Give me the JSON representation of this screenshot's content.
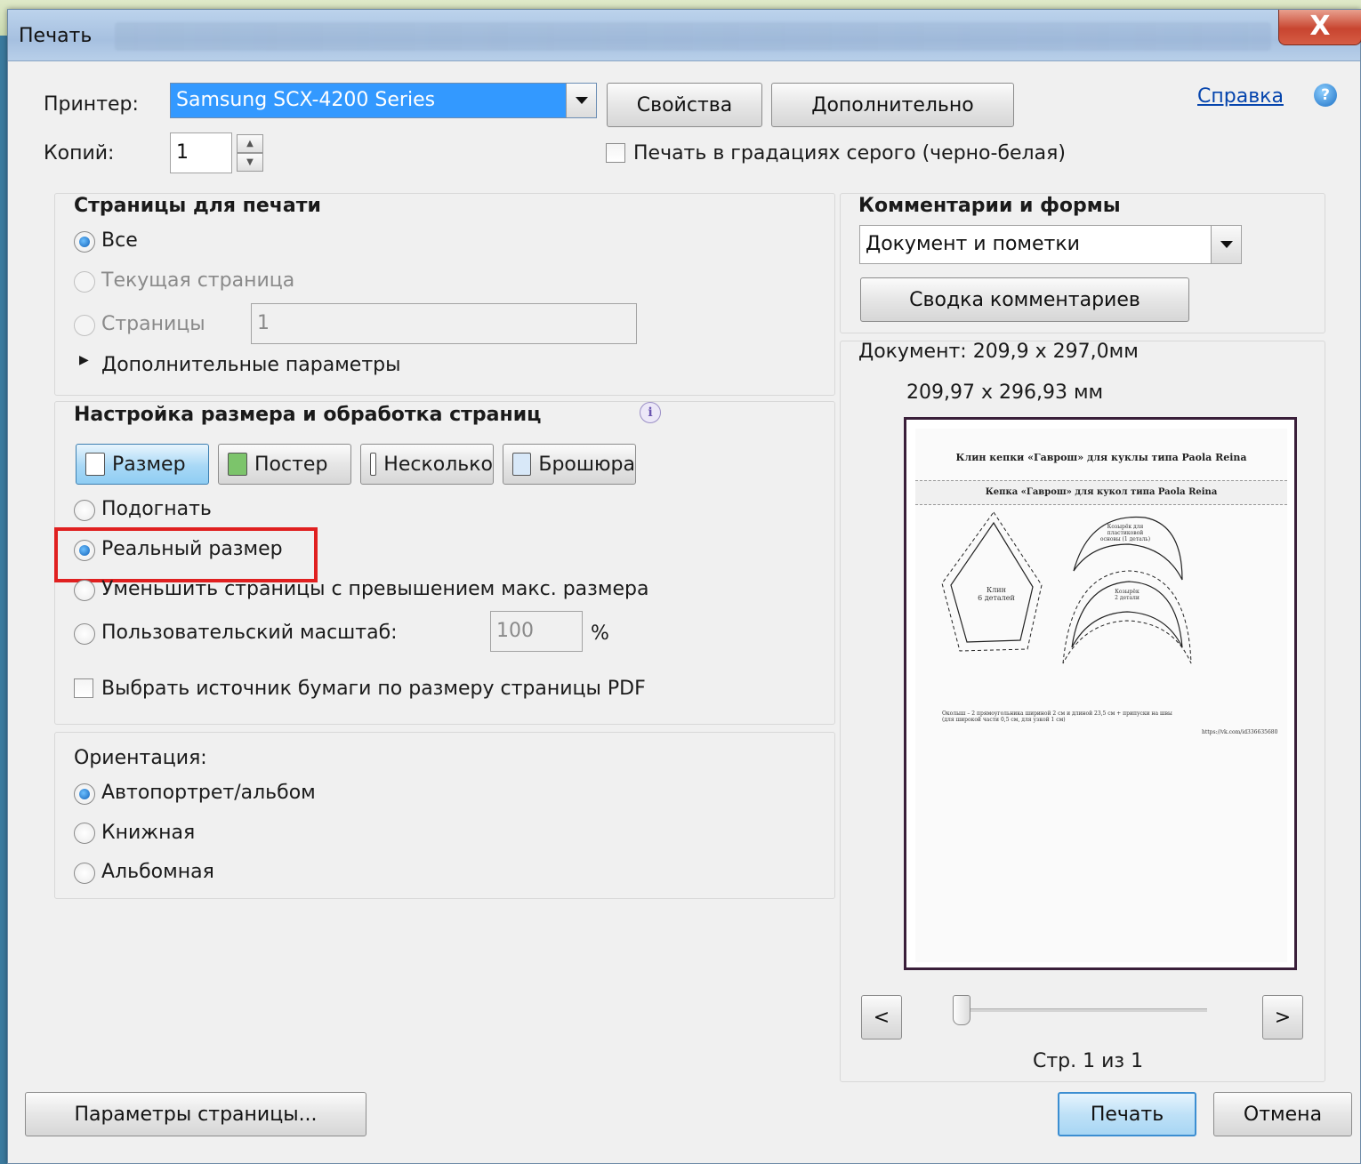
{
  "dialog": {
    "title": "Печать",
    "close_label": "X"
  },
  "printer": {
    "label": "Принтер:",
    "selected": "Samsung SCX-4200 Series",
    "properties_btn": "Свойства",
    "advanced_btn": "Дополнительно",
    "help_link": "Справка",
    "copies_label": "Копий:",
    "copies_value": "1",
    "grayscale_label": "Печать в градациях серого (черно-белая)",
    "grayscale_checked": false
  },
  "pages": {
    "heading": "Страницы для печати",
    "all": "Все",
    "current": "Текущая страница",
    "pages": "Страницы",
    "pages_value": "1",
    "more_options": "Дополнительные параметры",
    "selected": "all"
  },
  "sizing": {
    "heading": "Настройка размера и обработка страниц",
    "tabs": [
      "Размер",
      "Постер",
      "Несколько",
      "Брошюра"
    ],
    "active_tab": "Размер",
    "fit": "Подогнать",
    "actual": "Реальный размер",
    "shrink": "Уменьшить страницы с превышением макс. размера",
    "custom": "Пользовательский масштаб:",
    "custom_value": "100",
    "custom_unit": "%",
    "selected": "actual",
    "paper_source": "Выбрать источник бумаги по размеру страницы PDF",
    "paper_source_checked": false
  },
  "orientation": {
    "heading": "Ориентация:",
    "auto": "Автопортрет/альбом",
    "portrait": "Книжная",
    "landscape": "Альбомная",
    "selected": "auto"
  },
  "comments": {
    "heading": "Комментарии и формы",
    "selected": "Документ и пометки",
    "summary_btn": "Сводка комментариев"
  },
  "preview": {
    "doc_size": "Документ: 209,9 x 297,0мм",
    "page_size": "209,97 x 296,93 мм",
    "page_indicator": "Стр. 1 из 1",
    "prev": "<",
    "next": ">",
    "page": {
      "header": "Клин кепки «Гаврош» для куклы типа Paola Reina",
      "subheader": "Кепка «Гаврош» для кукол типа Paola Reina",
      "wedge_label": "Клин\n6 деталей",
      "visor_label": "Козырёк для пластиковой основы (1 деталь)",
      "visor2_label": "Козырёк\n2 детали",
      "footer_note": "Околыш – 2 прямоугольника шириной 2 см и длиной 23,5 см + припуски на швы\n(для широкой части 0,5 см, для узкой 1 см)",
      "footer_url": "https://vk.com/id336635680"
    }
  },
  "footer": {
    "page_setup_btn": "Параметры страницы...",
    "print_btn": "Печать",
    "cancel_btn": "Отмена"
  }
}
